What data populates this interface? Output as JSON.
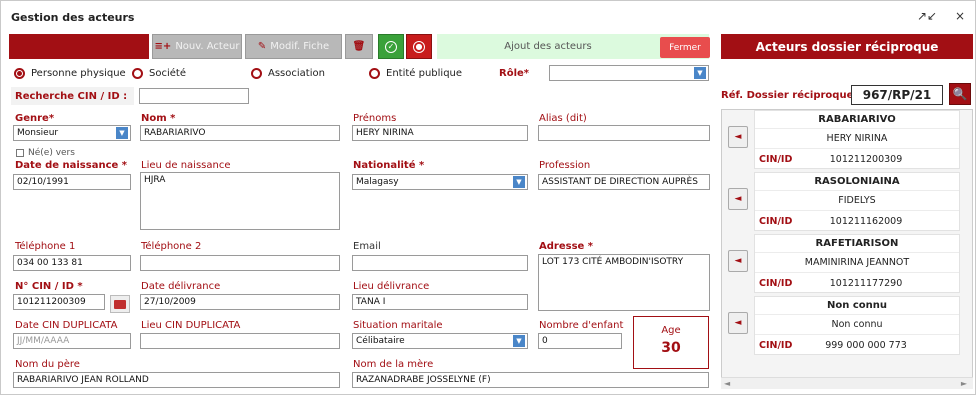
{
  "window": {
    "title": "Gestion des acteurs",
    "min_icon": "↗↙",
    "close_icon": "×"
  },
  "toolbar": {
    "nouv_acteur": "Nouv. Acteur",
    "modif_fiche": "Modif. Fiche",
    "ajout_text": "Ajout des acteurs",
    "fermer": "Fermer"
  },
  "right_header": "Acteurs dossier réciproque",
  "radios": [
    {
      "label": "Personne physique",
      "checked": true
    },
    {
      "label": "Société",
      "checked": false
    },
    {
      "label": "Association",
      "checked": false
    },
    {
      "label": "Entité publique",
      "checked": false
    }
  ],
  "role": {
    "label": "Rôle*",
    "value": ""
  },
  "recherche": {
    "label": "Recherche CIN / ID :",
    "value": ""
  },
  "form": {
    "genre": {
      "label": "Genre*",
      "value": "Monsieur"
    },
    "nom": {
      "label": "Nom *",
      "value": "RABARIARIVO"
    },
    "prenoms": {
      "label": "Prénoms",
      "value": "HERY NIRINA"
    },
    "alias": {
      "label": "Alias (dit)",
      "value": ""
    },
    "ne_vers": "Né(e) vers",
    "date_naissance": {
      "label": "Date de naissance *",
      "value": "02/10/1991"
    },
    "lieu_naissance": {
      "label": "Lieu de naissance",
      "value": "HJRA"
    },
    "nationalite": {
      "label": "Nationalité *",
      "value": "Malagasy"
    },
    "profession": {
      "label": "Profession",
      "value": "ASSISTANT DE DIRECTION AUPRÈS"
    },
    "telephone1": {
      "label": "Téléphone 1",
      "value": "034 00 133 81"
    },
    "telephone2": {
      "label": "Téléphone 2",
      "value": ""
    },
    "email": {
      "label": "Email",
      "value": ""
    },
    "adresse": {
      "label": "Adresse *",
      "value": "LOT 173 CITÉ AMBODIN'ISOTRY"
    },
    "cin": {
      "label": "N° CIN / ID *",
      "value": "101211200309"
    },
    "date_delivrance": {
      "label": "Date délivrance",
      "value": "27/10/2009"
    },
    "lieu_delivrance": {
      "label": "Lieu délivrance",
      "value": "TANA I"
    },
    "date_cin_dup": {
      "label": "Date CIN DUPLICATA",
      "placeholder": "JJ/MM/AAAA"
    },
    "lieu_cin_dup": {
      "label": "Lieu CIN DUPLICATA",
      "value": ""
    },
    "situation": {
      "label": "Situation maritale",
      "value": "Célibataire"
    },
    "nb_enfant": {
      "label": "Nombre d'enfant",
      "value": "0"
    },
    "age": {
      "label": "Age",
      "value": "30"
    },
    "nom_pere": {
      "label": "Nom du père",
      "value": "RABARIARIVO JEAN ROLLAND"
    },
    "nom_mere": {
      "label": "Nom de la mère",
      "value": "RAZANADRABE JOSSELYNE (F)"
    }
  },
  "ref": {
    "label": "Réf. Dossier réciproque:",
    "value": "967/RP/21"
  },
  "actors": [
    {
      "nom": "RABARIARIVO",
      "prenom": "HERY NIRINA",
      "cin_label": "CIN/ID",
      "cin": "101211200309"
    },
    {
      "nom": "RASOLONIAINA",
      "prenom": "FIDELYS",
      "cin_label": "CIN/ID",
      "cin": "101211162009"
    },
    {
      "nom": "RAFETIARISON",
      "prenom": "MAMINIRINA JEANNOT",
      "cin_label": "CIN/ID",
      "cin": "101211177290"
    },
    {
      "nom": "Non connu",
      "prenom": "Non connu",
      "cin_label": "CIN/ID",
      "cin": "999 000 000 773"
    }
  ],
  "colors": {
    "accent": "#a20f14",
    "ok": "#3aa13a",
    "cancel": "#c81c1c",
    "banner": "#dcfade"
  }
}
